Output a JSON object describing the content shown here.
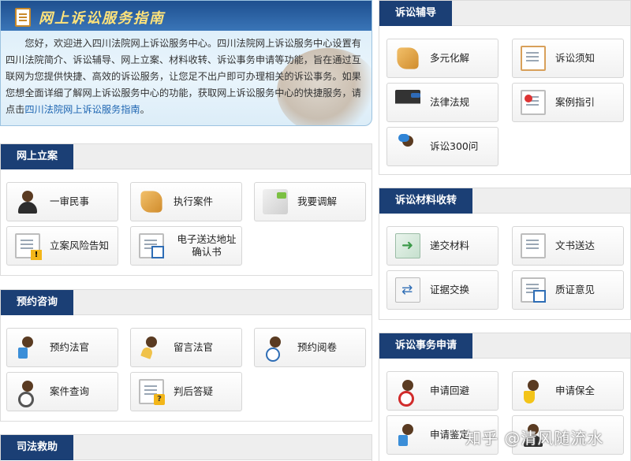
{
  "intro": {
    "title": "网上诉讼服务指南",
    "text_before_link": "您好，欢迎进入四川法院网上诉讼服务中心。四川法院网上诉讼服务中心设置有四川法院简介、诉讼辅导、网上立案、材料收转、诉讼事务申请等功能，旨在通过互联网为您提供快捷、高效的诉讼服务，让您足不出户即可办理相关的诉讼事务。如果您想全面详细了解网上诉讼服务中心的功能，获取网上诉讼服务中心的快捷服务，请点击",
    "link_text": "四川法院网上诉讼服务指南",
    "text_after_link": "。"
  },
  "sections": {
    "online_filing": {
      "title": "网上立案",
      "items": [
        "一审民事",
        "执行案件",
        "我要调解",
        "立案风险告知",
        "电子送达地址确认书"
      ]
    },
    "appointment": {
      "title": "预约咨询",
      "items": [
        "预约法官",
        "留言法官",
        "预约阅卷",
        "案件查询",
        "判后答疑"
      ]
    },
    "judicial_aid": {
      "title": "司法救助"
    },
    "litigation_guidance": {
      "title": "诉讼辅导",
      "items": [
        "多元化解",
        "诉讼须知",
        "法律法规",
        "案例指引",
        "诉讼300问"
      ]
    },
    "materials": {
      "title": "诉讼材料收转",
      "items": [
        "递交材料",
        "文书送达",
        "证据交换",
        "质证意见"
      ]
    },
    "affairs": {
      "title": "诉讼事务申请",
      "items": [
        "申请回避",
        "申请保全",
        "申请鉴定",
        ""
      ]
    }
  },
  "watermark": "知乎 @清风随流水"
}
